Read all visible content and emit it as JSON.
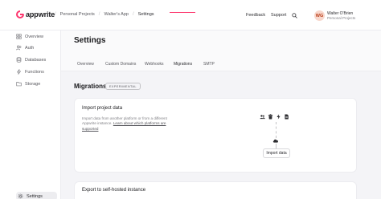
{
  "brand": {
    "name": "appwrite",
    "accent": "#fd366e"
  },
  "breadcrumbs": [
    "Personal Projects",
    "Walter's App",
    "Settings"
  ],
  "topbar": {
    "feedback": "Feedback",
    "support": "Support",
    "search_icon": "search-icon"
  },
  "user": {
    "initials": "WG",
    "name": "Walter O'Brien",
    "org": "Personal Projects"
  },
  "sidebar": {
    "items": [
      {
        "label": "Overview",
        "icon": "dashboard-icon"
      },
      {
        "label": "Auth",
        "icon": "users-icon"
      },
      {
        "label": "Databases",
        "icon": "database-icon"
      },
      {
        "label": "Functions",
        "icon": "lightning-icon"
      },
      {
        "label": "Storage",
        "icon": "folder-icon"
      }
    ],
    "settings": {
      "label": "Settings",
      "icon": "gear-icon"
    }
  },
  "page": {
    "title": "Settings"
  },
  "tabs": [
    "Overview",
    "Custom Domains",
    "Webhooks",
    "Migrations",
    "SMTP"
  ],
  "active_tab": "Migrations",
  "migrations": {
    "title": "Migrations",
    "badge": "EXPERIMENTAL",
    "import_card": {
      "title": "Import project data",
      "desc_plain": "Import data from another platform or from a different Appwrite instance.",
      "desc_link": "Learn about which platforms are supported",
      "button": "Import data"
    },
    "export_card": {
      "title": "Export to self-hosted instance"
    }
  }
}
